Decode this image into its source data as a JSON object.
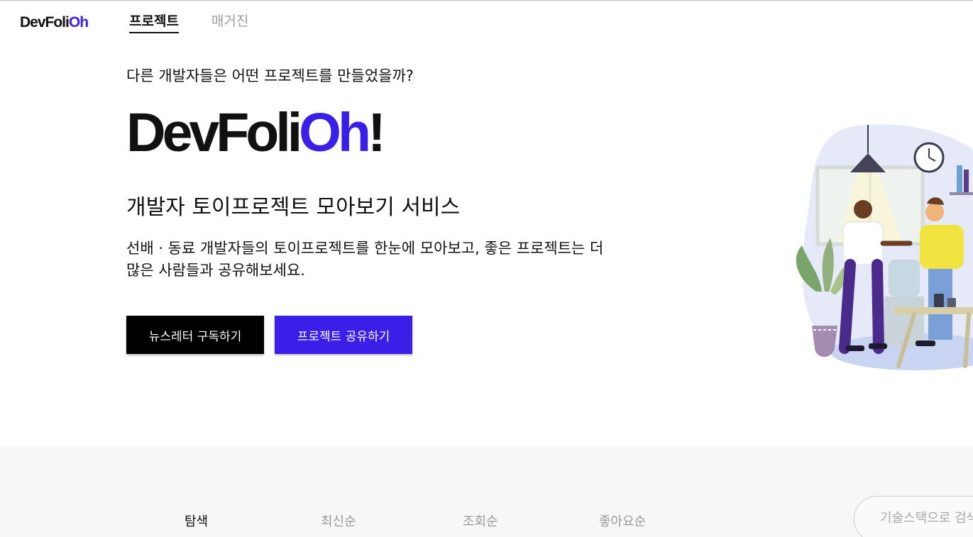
{
  "header": {
    "logo_main": "DevFoli",
    "logo_accent": "Oh",
    "nav": [
      {
        "label": "프로젝트"
      },
      {
        "label": "매거진"
      }
    ]
  },
  "hero": {
    "subtitle": "다른 개발자들은 어떤 프로젝트를 만들었을까?",
    "big_logo_main": "DevFoli",
    "big_logo_accent": "Oh",
    "big_logo_suffix": "!",
    "tagline": "개발자 토이프로젝트 모아보기 서비스",
    "desc_line1": "선배 · 동료 개발자들의 토이프로젝트를 한눈에 모아보고, 좋은 프로젝트는 더",
    "desc_line2": "많은 사람들과 공유해보세요.",
    "btn_subscribe": "뉴스레터 구독하기",
    "btn_share": "프로젝트 공유하기"
  },
  "bottom": {
    "tabs": [
      {
        "label": "탐색"
      },
      {
        "label": "최신순"
      },
      {
        "label": "조회순"
      },
      {
        "label": "좋아요순"
      }
    ],
    "search_placeholder": "기술스택으로 검색"
  },
  "colors": {
    "accent": "#3a1fe8",
    "primary_button": "#000000",
    "bottom_bg": "#f7f7f7"
  }
}
